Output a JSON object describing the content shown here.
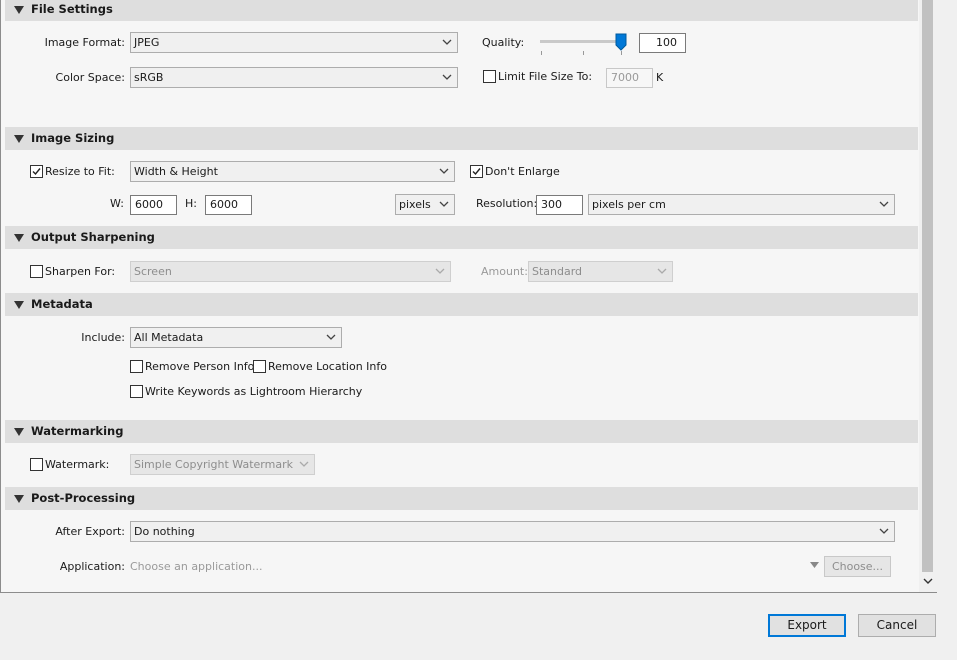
{
  "file_settings": {
    "title": "File Settings",
    "image_format_label": "Image Format:",
    "image_format_value": "JPEG",
    "quality_label": "Quality:",
    "quality_value": "100",
    "quality_level": 1.0,
    "color_space_label": "Color Space:",
    "color_space_value": "sRGB",
    "limit_file_size_label": "Limit File Size To:",
    "limit_file_size_checked": false,
    "limit_file_size_value": "7000",
    "limit_file_size_unit": "K"
  },
  "image_sizing": {
    "title": "Image Sizing",
    "resize_label": "Resize to Fit:",
    "resize_checked": true,
    "resize_mode": "Width & Height",
    "dont_enlarge_label": "Don't Enlarge",
    "dont_enlarge_checked": true,
    "w_label": "W:",
    "w_value": "6000",
    "h_label": "H:",
    "h_value": "6000",
    "units": "pixels",
    "resolution_label": "Resolution:",
    "resolution_value": "300",
    "resolution_units": "pixels per cm"
  },
  "output_sharpening": {
    "title": "Output Sharpening",
    "sharpen_label": "Sharpen For:",
    "sharpen_checked": false,
    "sharpen_for": "Screen",
    "amount_label": "Amount:",
    "amount_value": "Standard"
  },
  "metadata": {
    "title": "Metadata",
    "include_label": "Include:",
    "include_value": "All Metadata",
    "remove_person_label": "Remove Person Info",
    "remove_location_label": "Remove Location Info",
    "write_keywords_label": "Write Keywords as Lightroom Hierarchy"
  },
  "watermarking": {
    "title": "Watermarking",
    "watermark_label": "Watermark:",
    "watermark_value": "Simple Copyright Watermark"
  },
  "post_processing": {
    "title": "Post-Processing",
    "after_export_label": "After Export:",
    "after_export_value": "Do nothing",
    "application_label": "Application:",
    "application_placeholder": "Choose an application...",
    "choose_button": "Choose..."
  },
  "footer": {
    "export_button": "Export",
    "cancel_button": "Cancel"
  },
  "colors": {
    "header_bg": "#dedede",
    "panel_bg": "#f6f6f6",
    "slider_thumb": "#0078d7"
  }
}
